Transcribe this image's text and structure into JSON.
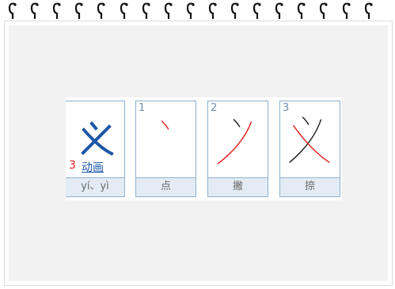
{
  "character": "义",
  "stroke_count": "3",
  "animation_label": "动画",
  "pinyin": "yí、yì",
  "strokes": [
    {
      "number": "1",
      "name": "点"
    },
    {
      "number": "2",
      "name": "撇"
    },
    {
      "number": "3",
      "name": "捺"
    }
  ],
  "colors": {
    "accent": "#1b57a5",
    "current_stroke": "#e02020",
    "border": "#8fb0cf",
    "label_bg": "#e3ecf4",
    "page_bg": "#f2f2f2"
  }
}
